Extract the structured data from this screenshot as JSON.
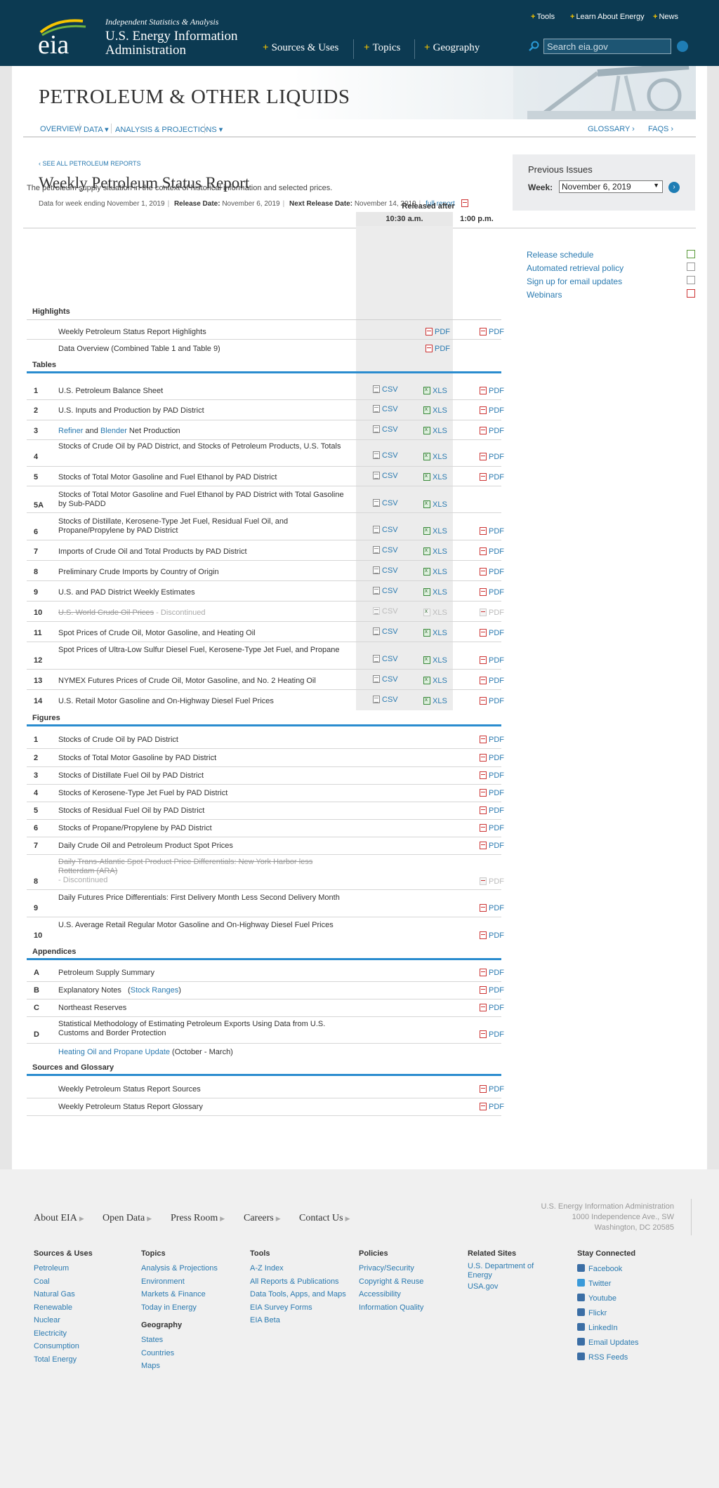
{
  "header": {
    "tagline": "Independent Statistics & Analysis",
    "agency_line1": "U.S. Energy Information",
    "agency_line2": "Administration",
    "logo_text": "eia",
    "utility_links": [
      "Tools",
      "Learn About Energy",
      "News"
    ],
    "main_nav": [
      "Sources & Uses",
      "Topics",
      "Geography"
    ],
    "search_placeholder": "Search eia.gov"
  },
  "banner": {
    "title": "PETROLEUM & OTHER LIQUIDS"
  },
  "subnav": {
    "left": [
      "OVERVIEW",
      "DATA ▾",
      "ANALYSIS & PROJECTIONS ▾"
    ],
    "right": [
      "GLOSSARY ›",
      "FAQS ›"
    ]
  },
  "report": {
    "see_all": "‹ SEE ALL PETROLEUM REPORTS",
    "title": "Weekly Petroleum Status Report",
    "data_week": "Data for week ending November 1, 2019",
    "release_label": "Release Date:",
    "release_date": "November 6, 2019",
    "next_label": "Next Release Date:",
    "next_date": "November 14, 2019",
    "full_report": "full report",
    "intro": "The petroleum supply situation in the context of historical information and selected prices."
  },
  "previous_issues": {
    "title": "Previous Issues",
    "week_label": "Week:",
    "selected": "November 6, 2019"
  },
  "columns": {
    "released_after": "Released after",
    "time1": "10:30 a.m.",
    "time2": "1:00 p.m."
  },
  "side_links": [
    "Release schedule",
    "Automated retrieval policy",
    "Sign up for email updates",
    "Webinars"
  ],
  "sections": {
    "highlights": "Highlights",
    "tables": "Tables",
    "figures": "Figures",
    "appendices": "Appendices",
    "sources": "Sources and Glossary"
  },
  "highlights": [
    {
      "label": "Weekly Petroleum Status Report Highlights",
      "pdf1": "PDF",
      "pdf2": "PDF"
    },
    {
      "label": "Data Overview (Combined Table 1 and Table 9)",
      "pdf1": "PDF"
    }
  ],
  "tables": [
    {
      "num": "1",
      "label": "U.S. Petroleum Balance Sheet",
      "csv": "CSV",
      "xls": "XLS",
      "pdf": "PDF"
    },
    {
      "num": "2",
      "label": "U.S. Inputs and Production by PAD District",
      "csv": "CSV",
      "xls": "XLS",
      "pdf": "PDF"
    },
    {
      "num": "3",
      "label_a": "Refiner",
      "label_b": " and ",
      "label_c": "Blender",
      "label_d": " Net Production",
      "csv": "CSV",
      "xls": "XLS",
      "pdf": "PDF"
    },
    {
      "num": "4",
      "label": "Stocks of Crude Oil by PAD District, and Stocks of Petroleum Products, U.S. Totals",
      "csv": "CSV",
      "xls": "XLS",
      "pdf": "PDF"
    },
    {
      "num": "5",
      "label": "Stocks of Total Motor Gasoline and Fuel Ethanol by PAD District",
      "csv": "CSV",
      "xls": "XLS",
      "pdf": "PDF"
    },
    {
      "num": "5A",
      "label": "Stocks of Total Motor Gasoline and Fuel Ethanol by PAD District with Total Gasoline by Sub-PADD",
      "csv": "CSV",
      "xls": "XLS"
    },
    {
      "num": "6",
      "label": "Stocks of Distillate, Kerosene-Type Jet Fuel, Residual Fuel Oil, and Propane/Propylene by PAD District",
      "csv": "CSV",
      "xls": "XLS",
      "pdf": "PDF"
    },
    {
      "num": "7",
      "label": "Imports of Crude Oil and Total Products by PAD District",
      "csv": "CSV",
      "xls": "XLS",
      "pdf": "PDF"
    },
    {
      "num": "8",
      "label": "Preliminary Crude Imports by Country of Origin",
      "csv": "CSV",
      "xls": "XLS",
      "pdf": "PDF"
    },
    {
      "num": "9",
      "label": "U.S. and PAD District Weekly Estimates",
      "csv": "CSV",
      "xls": "XLS",
      "pdf": "PDF"
    },
    {
      "num": "10",
      "label": "U.S. World Crude Oil Prices",
      "note": " - Discontinued",
      "csv": "CSV",
      "xls": "XLS",
      "pdf": "PDF"
    },
    {
      "num": "11",
      "label": "Spot Prices of Crude Oil, Motor Gasoline, and Heating Oil",
      "csv": "CSV",
      "xls": "XLS",
      "pdf": "PDF"
    },
    {
      "num": "12",
      "label": "Spot Prices of Ultra-Low Sulfur Diesel Fuel, Kerosene-Type Jet Fuel, and Propane",
      "csv": "CSV",
      "xls": "XLS",
      "pdf": "PDF"
    },
    {
      "num": "13",
      "label": "NYMEX Futures Prices of Crude Oil, Motor Gasoline, and No. 2 Heating Oil",
      "csv": "CSV",
      "xls": "XLS",
      "pdf": "PDF"
    },
    {
      "num": "14",
      "label": "U.S. Retail Motor Gasoline and On-Highway Diesel Fuel Prices",
      "csv": "CSV",
      "xls": "XLS",
      "pdf": "PDF"
    }
  ],
  "figures": [
    {
      "num": "1",
      "label": "Stocks of Crude Oil by PAD District",
      "pdf": "PDF"
    },
    {
      "num": "2",
      "label": "Stocks of Total Motor Gasoline by PAD District",
      "pdf": "PDF"
    },
    {
      "num": "3",
      "label": "Stocks of Distillate Fuel Oil by PAD District",
      "pdf": "PDF"
    },
    {
      "num": "4",
      "label": "Stocks of Kerosene-Type Jet Fuel by PAD District",
      "pdf": "PDF"
    },
    {
      "num": "5",
      "label": "Stocks of Residual Fuel Oil by PAD District",
      "pdf": "PDF"
    },
    {
      "num": "6",
      "label": "Stocks of Propane/Propylene by PAD District",
      "pdf": "PDF"
    },
    {
      "num": "7",
      "label": "Daily Crude Oil and Petroleum Product Spot Prices",
      "pdf": "PDF"
    },
    {
      "num": "8",
      "label": "Daily Trans-Atlantic Spot Product Price Differentials: New York Harbor less Rotterdam (ARA)",
      "note": "- Discontinued",
      "pdf": "PDF"
    },
    {
      "num": "9",
      "label": "Daily Futures Price Differentials: First Delivery Month Less Second Delivery Month",
      "pdf": "PDF"
    },
    {
      "num": "10",
      "label": "U.S. Average Retail Regular Motor Gasoline and On-Highway Diesel Fuel Prices",
      "pdf": "PDF"
    }
  ],
  "appendices": [
    {
      "num": "A",
      "label": "Petroleum Supply Summary",
      "pdf": "PDF"
    },
    {
      "num": "B",
      "label": "Explanatory Notes",
      "extra": "Stock Ranges",
      "pdf": "PDF"
    },
    {
      "num": "C",
      "label": "Northeast Reserves",
      "pdf": "PDF"
    },
    {
      "num": "D",
      "label": "Statistical Methodology of Estimating Petroleum Exports Using Data from U.S. Customs and Border Protection",
      "pdf": "PDF"
    },
    {
      "num": "",
      "label": "Heating Oil and Propane Update",
      "extra": " (October - March)"
    }
  ],
  "sources_glossary": [
    {
      "label": "Weekly Petroleum Status Report Sources",
      "pdf": "PDF"
    },
    {
      "label": "Weekly Petroleum Status Report Glossary",
      "pdf": "PDF"
    }
  ],
  "footer": {
    "top_links": [
      "About EIA",
      "Open Data",
      "Press Room",
      "Careers",
      "Contact Us"
    ],
    "address": [
      "U.S. Energy Information Administration",
      "1000 Independence Ave., SW",
      "Washington, DC 20585"
    ],
    "columns": {
      "sources": {
        "title": "Sources & Uses",
        "items": [
          "Petroleum",
          "Coal",
          "Natural Gas",
          "Renewable",
          "Nuclear",
          "Electricity",
          "Consumption",
          "Total Energy"
        ]
      },
      "topics": {
        "title": "Topics",
        "items": [
          "Analysis & Projections",
          "Environment",
          "Markets & Finance",
          "Today in Energy"
        ]
      },
      "geography": {
        "title": "Geography",
        "items": [
          "States",
          "Countries",
          "Maps"
        ]
      },
      "tools": {
        "title": "Tools",
        "items": [
          "A-Z Index",
          "All Reports & Publications",
          "Data Tools, Apps, and Maps",
          "EIA Survey Forms",
          "EIA Beta"
        ]
      },
      "policies": {
        "title": "Policies",
        "items": [
          "Privacy/Security",
          "Copyright & Reuse",
          "Accessibility",
          "Information Quality"
        ]
      },
      "related": {
        "title": "Related Sites",
        "items": [
          "U.S. Department of",
          "Energy",
          "USA.gov"
        ]
      },
      "social": {
        "title": "Stay Connected",
        "items": [
          "Facebook",
          "Twitter",
          "Youtube",
          "Flickr",
          "LinkedIn",
          "Email Updates",
          "RSS Feeds"
        ]
      }
    }
  },
  "colors": {
    "header_bg": "#0c3a52",
    "accent_blue": "#2a8ccf",
    "link": "#2a7ab0",
    "nav_plus": "#f5c400"
  }
}
